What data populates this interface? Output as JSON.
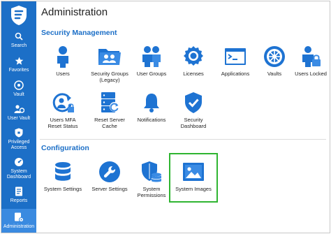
{
  "sidebar": {
    "items": [
      {
        "label": "Search",
        "icon": "search-icon"
      },
      {
        "label": "Favorites",
        "icon": "star-icon"
      },
      {
        "label": "Vault",
        "icon": "vault-icon"
      },
      {
        "label": "User Vault",
        "icon": "user-vault-icon"
      },
      {
        "label": "Privileged\nAccess",
        "icon": "shield-icon"
      },
      {
        "label": "System\nDashboard",
        "icon": "dashboard-icon"
      },
      {
        "label": "Reports",
        "icon": "reports-icon"
      },
      {
        "label": "Administration",
        "icon": "administration-icon"
      }
    ]
  },
  "page_title": "Administration",
  "sections": {
    "security": {
      "title": "Security Management",
      "tiles": [
        {
          "label": "Users"
        },
        {
          "label": "Security Groups\n(Legacy)"
        },
        {
          "label": "User Groups"
        },
        {
          "label": "Licenses"
        },
        {
          "label": "Applications"
        },
        {
          "label": "Vaults"
        },
        {
          "label": "Users Locked"
        },
        {
          "label": "Users MFA\nReset Status"
        },
        {
          "label": "Reset Server\nCache"
        },
        {
          "label": "Notifications"
        },
        {
          "label": "Security\nDashboard"
        }
      ]
    },
    "configuration": {
      "title": "Configuration",
      "tiles": [
        {
          "label": "System Settings"
        },
        {
          "label": "Server Settings"
        },
        {
          "label": "System\nPermissions"
        },
        {
          "label": "System Images"
        }
      ]
    }
  },
  "colors": {
    "sidebar": "#1c6fc7",
    "accent": "#1c6fc7",
    "icon_blue": "#1e73d2",
    "highlight": "#2fb531"
  }
}
